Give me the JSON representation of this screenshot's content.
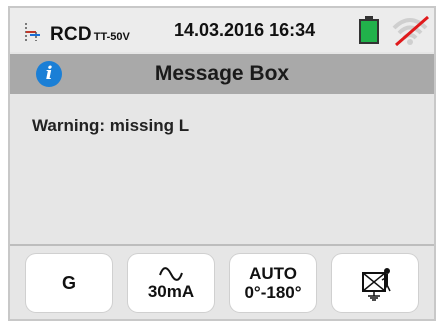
{
  "status_bar": {
    "mode": "RCD",
    "mode_sub": "TT-50V",
    "datetime": "14.03.2016  16:34",
    "battery_color": "#21b24b",
    "wifi_disabled_color": "#e0191b"
  },
  "title_bar": {
    "title": "Message Box",
    "info_icon": "i"
  },
  "message": {
    "text": "Warning: missing L"
  },
  "buttons": {
    "b1": "G",
    "b2_current": "30mA",
    "b3_line1": "AUTO",
    "b3_line2": "0°-180°"
  },
  "icons": {
    "mode": "rcd-icon",
    "battery": "battery-icon",
    "wifi": "wifi-off-icon",
    "info": "info-icon",
    "sine": "sine-wave-icon",
    "grounding": "grounding-disabled-icon"
  }
}
